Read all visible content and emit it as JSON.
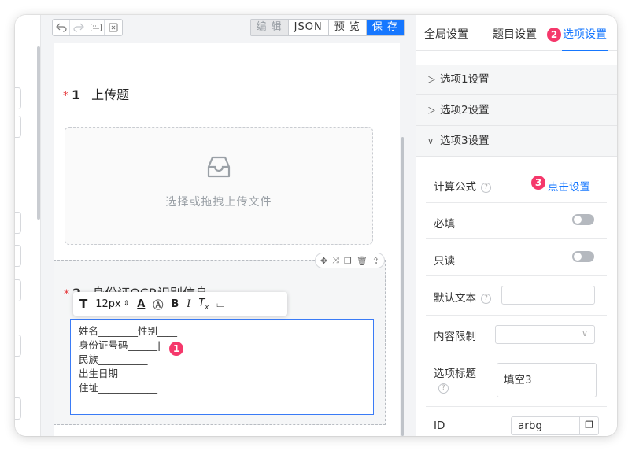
{
  "toolbar": {
    "tools": [
      "undo-icon",
      "redo-icon",
      "keyboard-icon",
      "clear-icon"
    ],
    "modes": [
      "编 辑",
      "JSON",
      "预 览",
      "保 存"
    ]
  },
  "questions": [
    {
      "number": "1",
      "title": "上传题",
      "upload_text": "选择或拖拽上传文件"
    },
    {
      "number": "2",
      "title": "身份证OCR识别信息",
      "editor_lines": [
        "姓名________性别____",
        "身份证号码______|",
        "民族__________",
        "出生日期_______",
        "住址____________"
      ]
    }
  ],
  "format_bar": {
    "text_icon": "T",
    "font_size": "12px",
    "bold": "B",
    "italic": "I"
  },
  "markers": [
    "1",
    "2",
    "3"
  ],
  "panel": {
    "tabs": [
      "全局设置",
      "题目设置",
      "选项设置"
    ],
    "active_tab": "选项设置",
    "sections": [
      "选项1设置",
      "选项2设置",
      "选项3设置"
    ],
    "formula_label": "计算公式",
    "formula_link": "点击设置",
    "required_label": "必填",
    "readonly_label": "只读",
    "default_text_label": "默认文本",
    "limit_label": "内容限制",
    "option_title_label": "选项标题",
    "option_title_value": "填空3",
    "id_label": "ID",
    "id_value": "arbg"
  },
  "colors": {
    "accent": "#1677ff",
    "marker": "#f5386b",
    "required": "#e5383b"
  }
}
